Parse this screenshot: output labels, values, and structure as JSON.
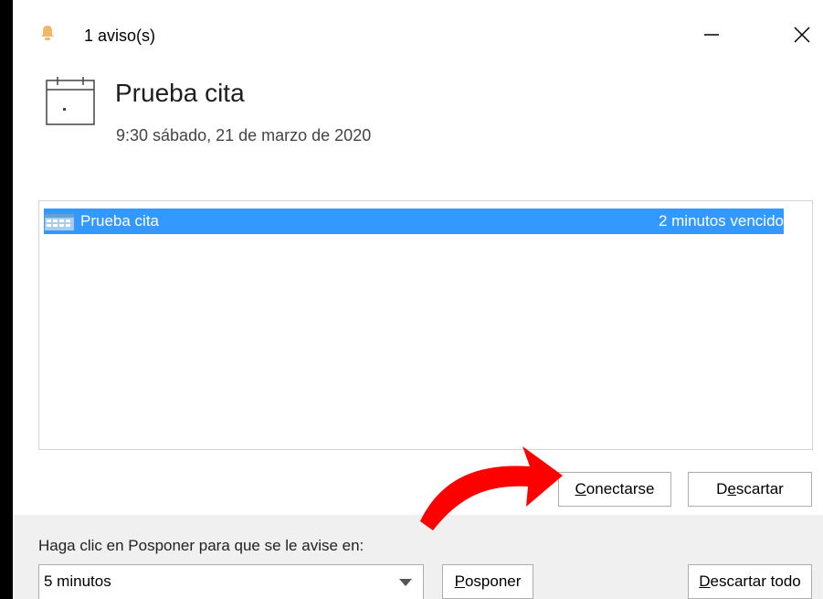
{
  "window": {
    "title": "1 aviso(s)",
    "accent_color": "#3399ff"
  },
  "reminder": {
    "subject": "Prueba cita",
    "when": "9:30 sábado, 21 de marzo de 2020"
  },
  "list": {
    "items": [
      {
        "subject": "Prueba cita",
        "due": "2 minutos vencido",
        "selected": true,
        "icon": "calendar-icon"
      }
    ]
  },
  "buttons": {
    "join": {
      "accel": "C",
      "rest": "onectarse"
    },
    "dismiss": {
      "pre": "D",
      "accel": "e",
      "rest": "scartar"
    },
    "snooze": {
      "accel": "P",
      "rest": "osponer"
    },
    "dismiss_all": {
      "accel": "D",
      "rest": "escartar todo"
    }
  },
  "snooze": {
    "label": "Haga clic en Posponer para que se le avise en:",
    "selected": "5 minutos"
  },
  "annotation": {
    "arrow_color": "#ff0000"
  }
}
